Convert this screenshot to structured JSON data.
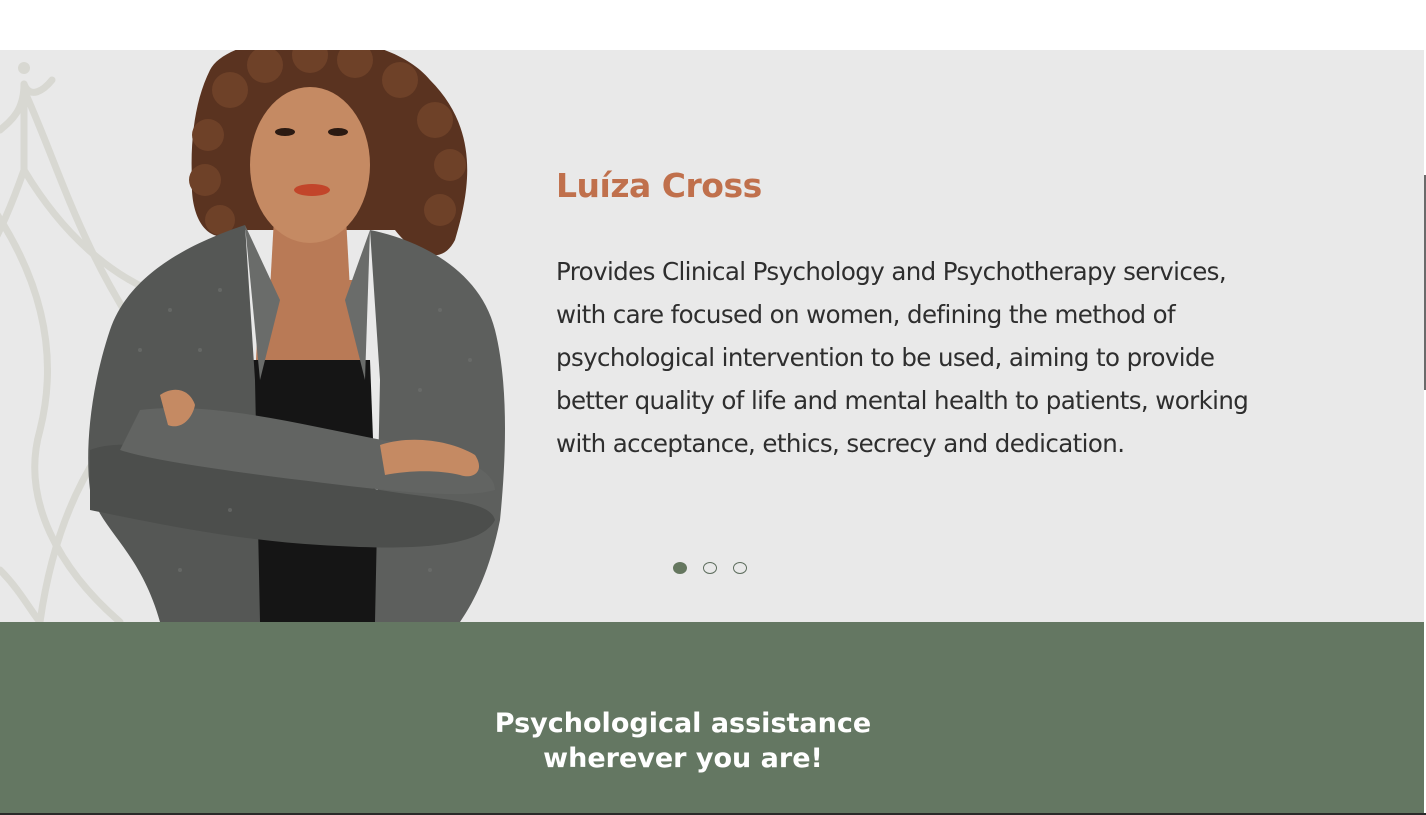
{
  "colors": {
    "hero_background": "#e9e9e9",
    "name_accent": "#c0704c",
    "body_text": "#2e2e2e",
    "band_green": "#647762",
    "dot_active": "#65775f"
  },
  "profile": {
    "name": "Luíza Cross",
    "description": "Provides Clinical Psychology and Psychotherapy services, with care focused on women, defining the method of psychological intervention to be used, aiming to provide better quality of life and mental health to patients, working with acceptance, ethics, secrecy and dedication."
  },
  "carousel": {
    "total_slides": 3,
    "active_index": 0
  },
  "band": {
    "line1": "Psychological assistance",
    "line2": "wherever you are!"
  }
}
